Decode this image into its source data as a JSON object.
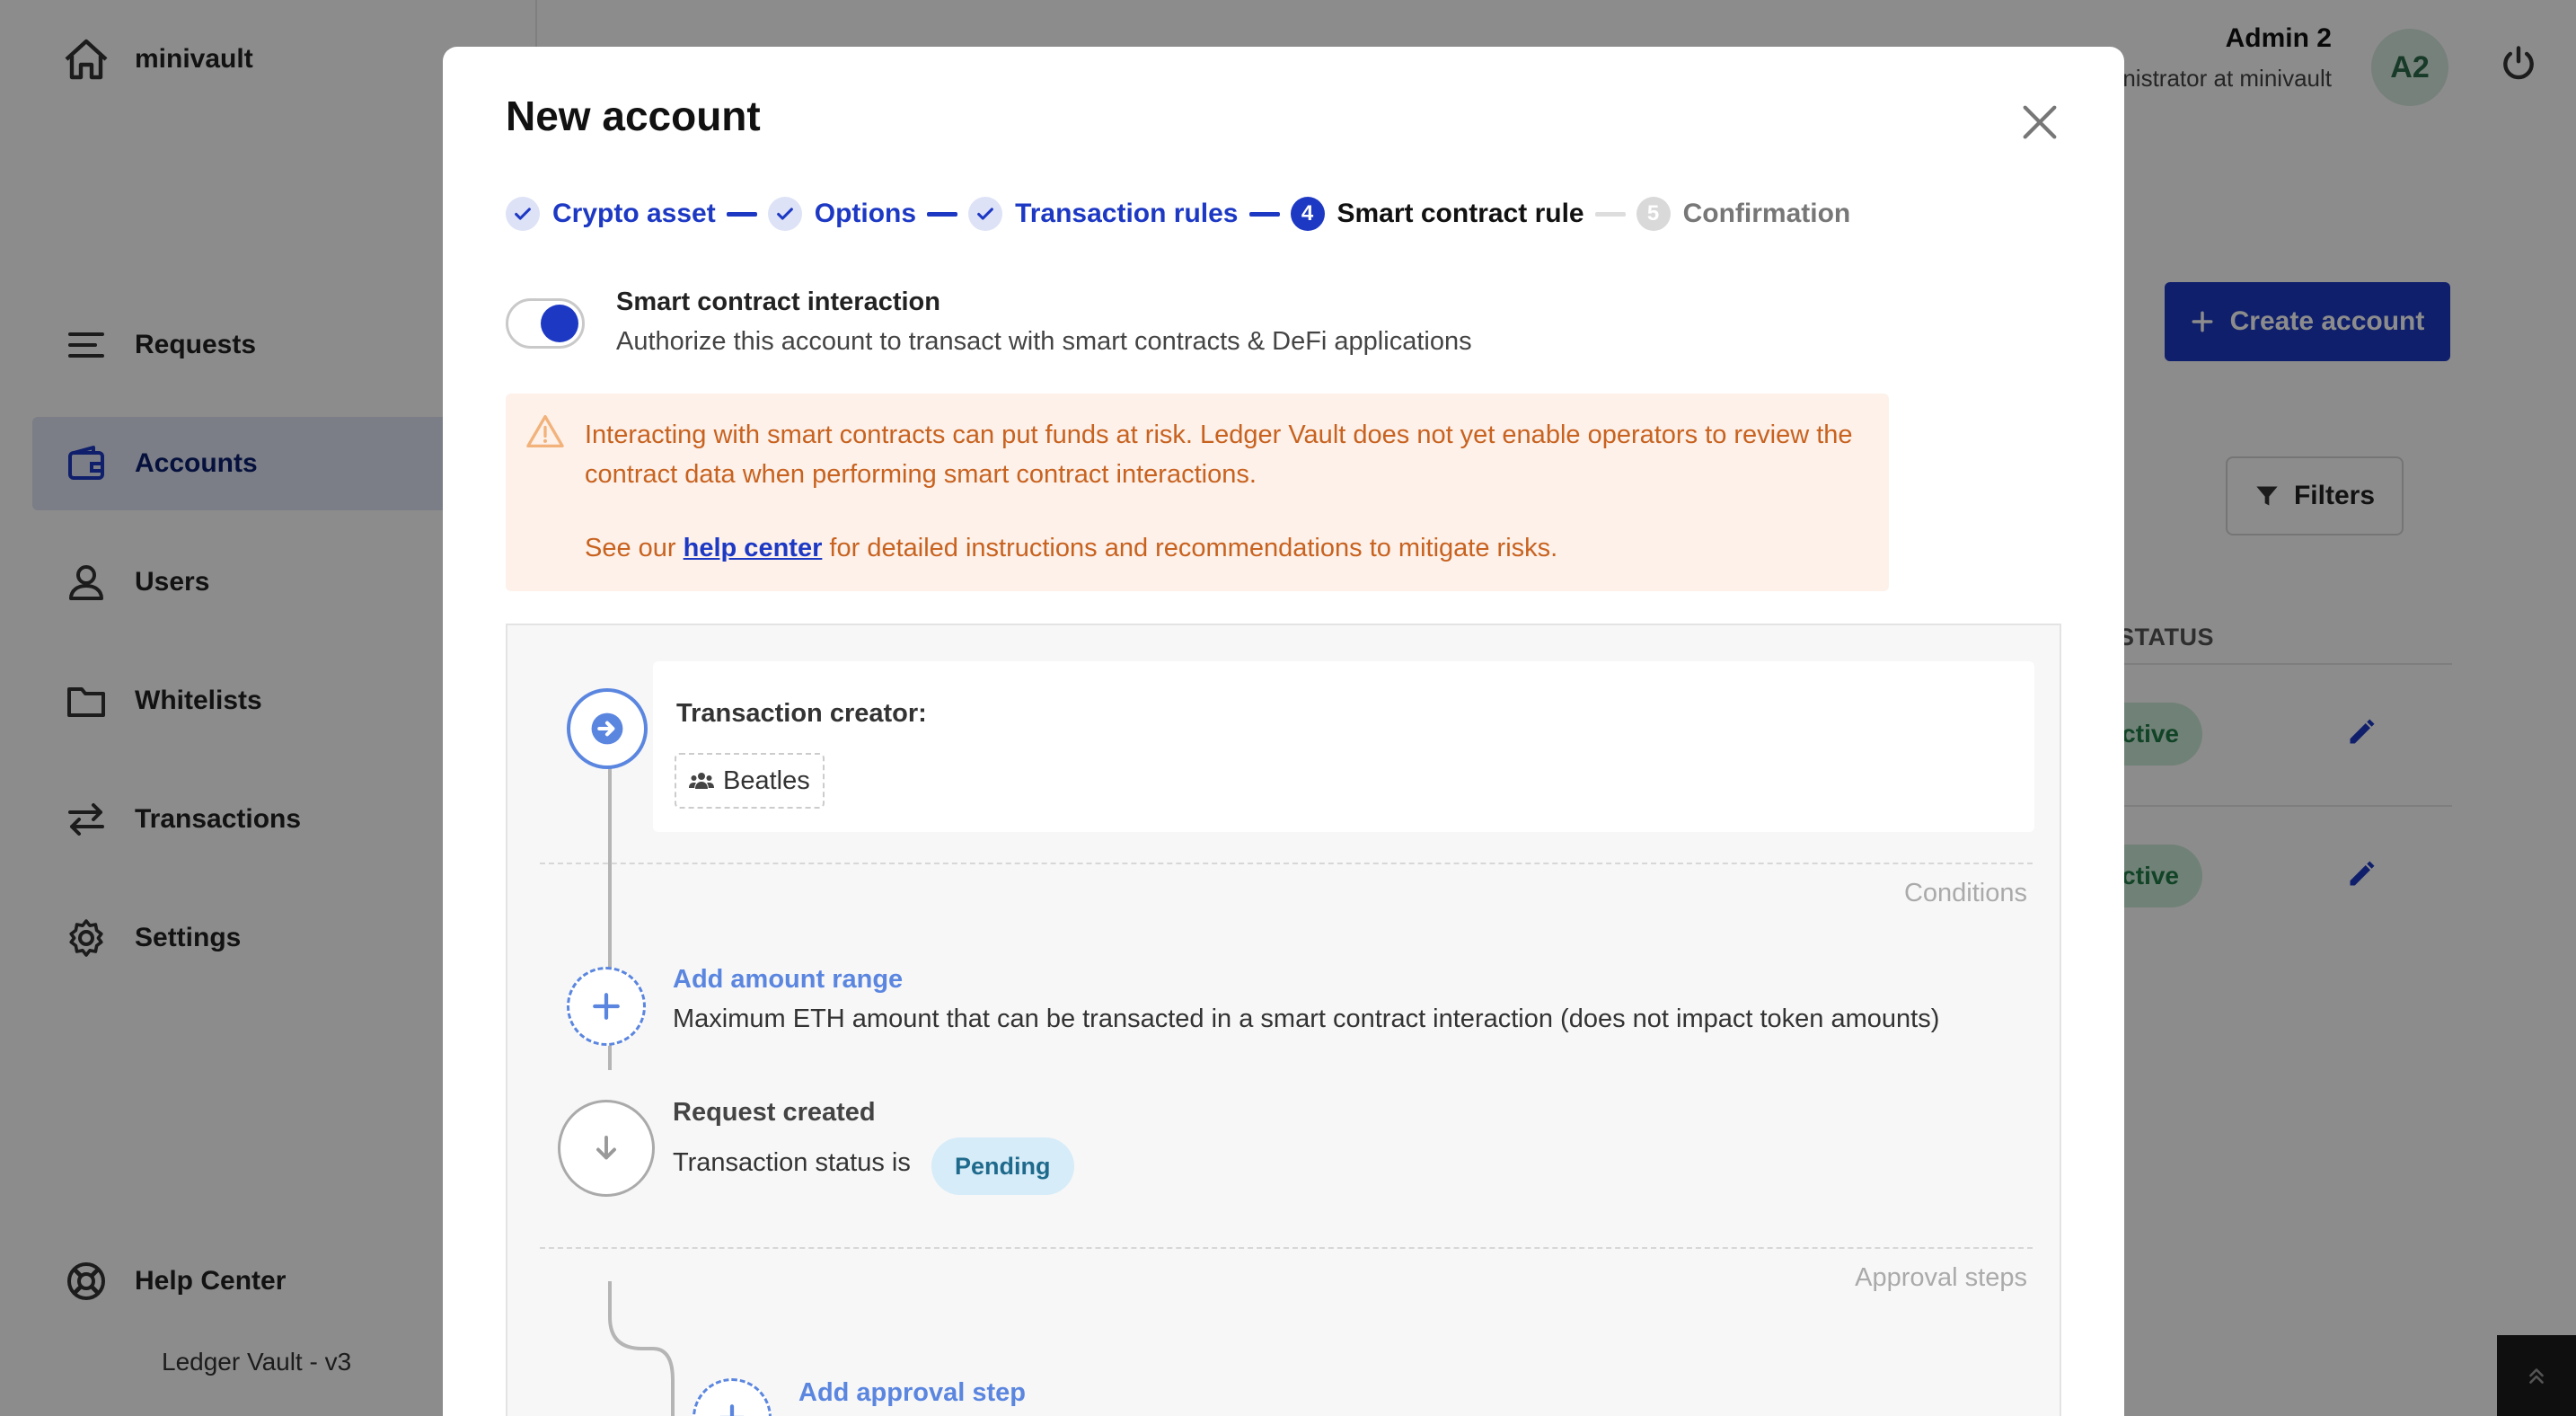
{
  "app": {
    "brand": "minivault",
    "version": "Ledger Vault - v3"
  },
  "sidebar": {
    "items": [
      {
        "label": "Requests"
      },
      {
        "label": "Accounts"
      },
      {
        "label": "Users"
      },
      {
        "label": "Whitelists"
      },
      {
        "label": "Transactions"
      },
      {
        "label": "Settings"
      }
    ],
    "help": "Help Center"
  },
  "header": {
    "user_name": "Admin 2",
    "user_role": "Administrator at minivault",
    "avatar": "A2"
  },
  "background": {
    "create_button": "Create account",
    "filters_button": "Filters",
    "status_header": "STATUS",
    "rows": [
      {
        "status": "Active"
      },
      {
        "status": "Active"
      }
    ]
  },
  "modal": {
    "title": "New account",
    "steps": [
      {
        "label": "Crypto asset",
        "state": "done"
      },
      {
        "label": "Options",
        "state": "done"
      },
      {
        "label": "Transaction rules",
        "state": "done"
      },
      {
        "label": "Smart contract rule",
        "state": "current",
        "number": "4"
      },
      {
        "label": "Confirmation",
        "state": "todo",
        "number": "5"
      }
    ],
    "toggle": {
      "title": "Smart contract interaction",
      "description": "Authorize this account to transact with smart contracts & DeFi applications",
      "on": true
    },
    "warning": {
      "text": "Interacting with smart contracts can put funds at risk. Ledger Vault does not yet enable operators to review the contract data when performing smart contract interactions.",
      "prefix": "See our",
      "link": "help center",
      "suffix": "for detailed instructions and recommendations to mitigate risks."
    },
    "flow": {
      "creator_label": "Transaction creator:",
      "creator_group": "Beatles",
      "conditions_label": "Conditions",
      "add_amount": "Add amount range",
      "amount_desc": "Maximum ETH amount that can be transacted in a smart contract interaction (does not impact token amounts)",
      "request_created": "Request created",
      "status_prefix": "Transaction status is",
      "status_badge": "Pending",
      "approval_label": "Approval steps",
      "add_approval": "Add approval step"
    }
  },
  "colors": {
    "primary": "#1d39c4",
    "warning": "#c8621f",
    "warning_bg": "#fdf1ea",
    "link_light": "#5b86e0"
  }
}
